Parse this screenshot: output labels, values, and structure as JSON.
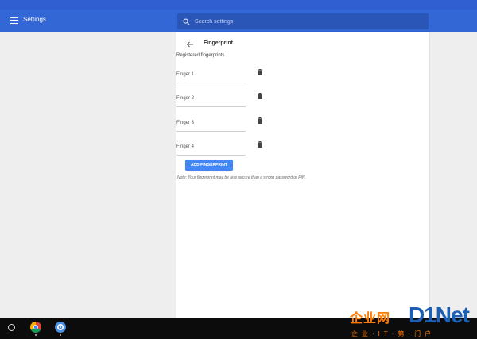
{
  "header": {
    "title": "Settings",
    "search_placeholder": "Search settings"
  },
  "page": {
    "title": "Fingerprint",
    "section_label": "Registered fingerprints",
    "fingers": [
      {
        "label": "Finger 1"
      },
      {
        "label": "Finger 2"
      },
      {
        "label": "Finger 3"
      },
      {
        "label": "Finger 4"
      }
    ],
    "add_button": "ADD FINGERPRINT",
    "note": "Note: Your fingerprint may be less secure than a strong password or PIN."
  },
  "shelf": {
    "apps": [
      "launcher-icon",
      "chrome-icon",
      "settings-icon"
    ]
  },
  "watermark": {
    "cn": "企业网",
    "logo": "D1Net",
    "sub": "企业·IT·第·门户"
  },
  "colors": {
    "appbar": "#3367d6",
    "accent": "#4285f4",
    "shelf": "#0c0c0c",
    "watermark_orange": "#ff7a00",
    "watermark_blue": "#1a5fb4"
  }
}
